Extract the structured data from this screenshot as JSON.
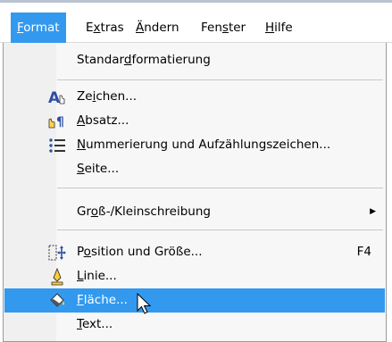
{
  "menubar": {
    "items": [
      {
        "pre": "",
        "hk": "F",
        "post": "ormat"
      },
      {
        "pre": "E",
        "hk": "x",
        "post": "tras"
      },
      {
        "pre": "",
        "hk": "Ä",
        "post": "ndern"
      },
      {
        "pre": "Fen",
        "hk": "s",
        "post": "ter"
      },
      {
        "pre": "",
        "hk": "H",
        "post": "ilfe"
      }
    ]
  },
  "menu": {
    "standard": {
      "pre": "Standar",
      "hk": "d",
      "post": "formatierung"
    },
    "zeichen": {
      "pre": "Ze",
      "hk": "i",
      "post": "chen..."
    },
    "absatz": {
      "pre": "",
      "hk": "A",
      "post": "bsatz..."
    },
    "nummer": {
      "pre": "",
      "hk": "N",
      "post": "ummerierung und Aufzählungszeichen..."
    },
    "seite": {
      "pre": "",
      "hk": "S",
      "post": "eite..."
    },
    "gross": {
      "pre": "Gr",
      "hk": "o",
      "post": "ß-/Kleinschreibung"
    },
    "position": {
      "pre": "P",
      "hk": "o",
      "post": "sition und Größe..."
    },
    "position_shortcut": "F4",
    "linie": {
      "pre": "",
      "hk": "L",
      "post": "inie..."
    },
    "flaeche": {
      "pre": "",
      "hk": "F",
      "post": "läche..."
    },
    "text": {
      "pre": "",
      "hk": "T",
      "post": "ext..."
    }
  },
  "colors": {
    "highlight": "#3399ee",
    "menu_bg": "#f7f7f7"
  }
}
